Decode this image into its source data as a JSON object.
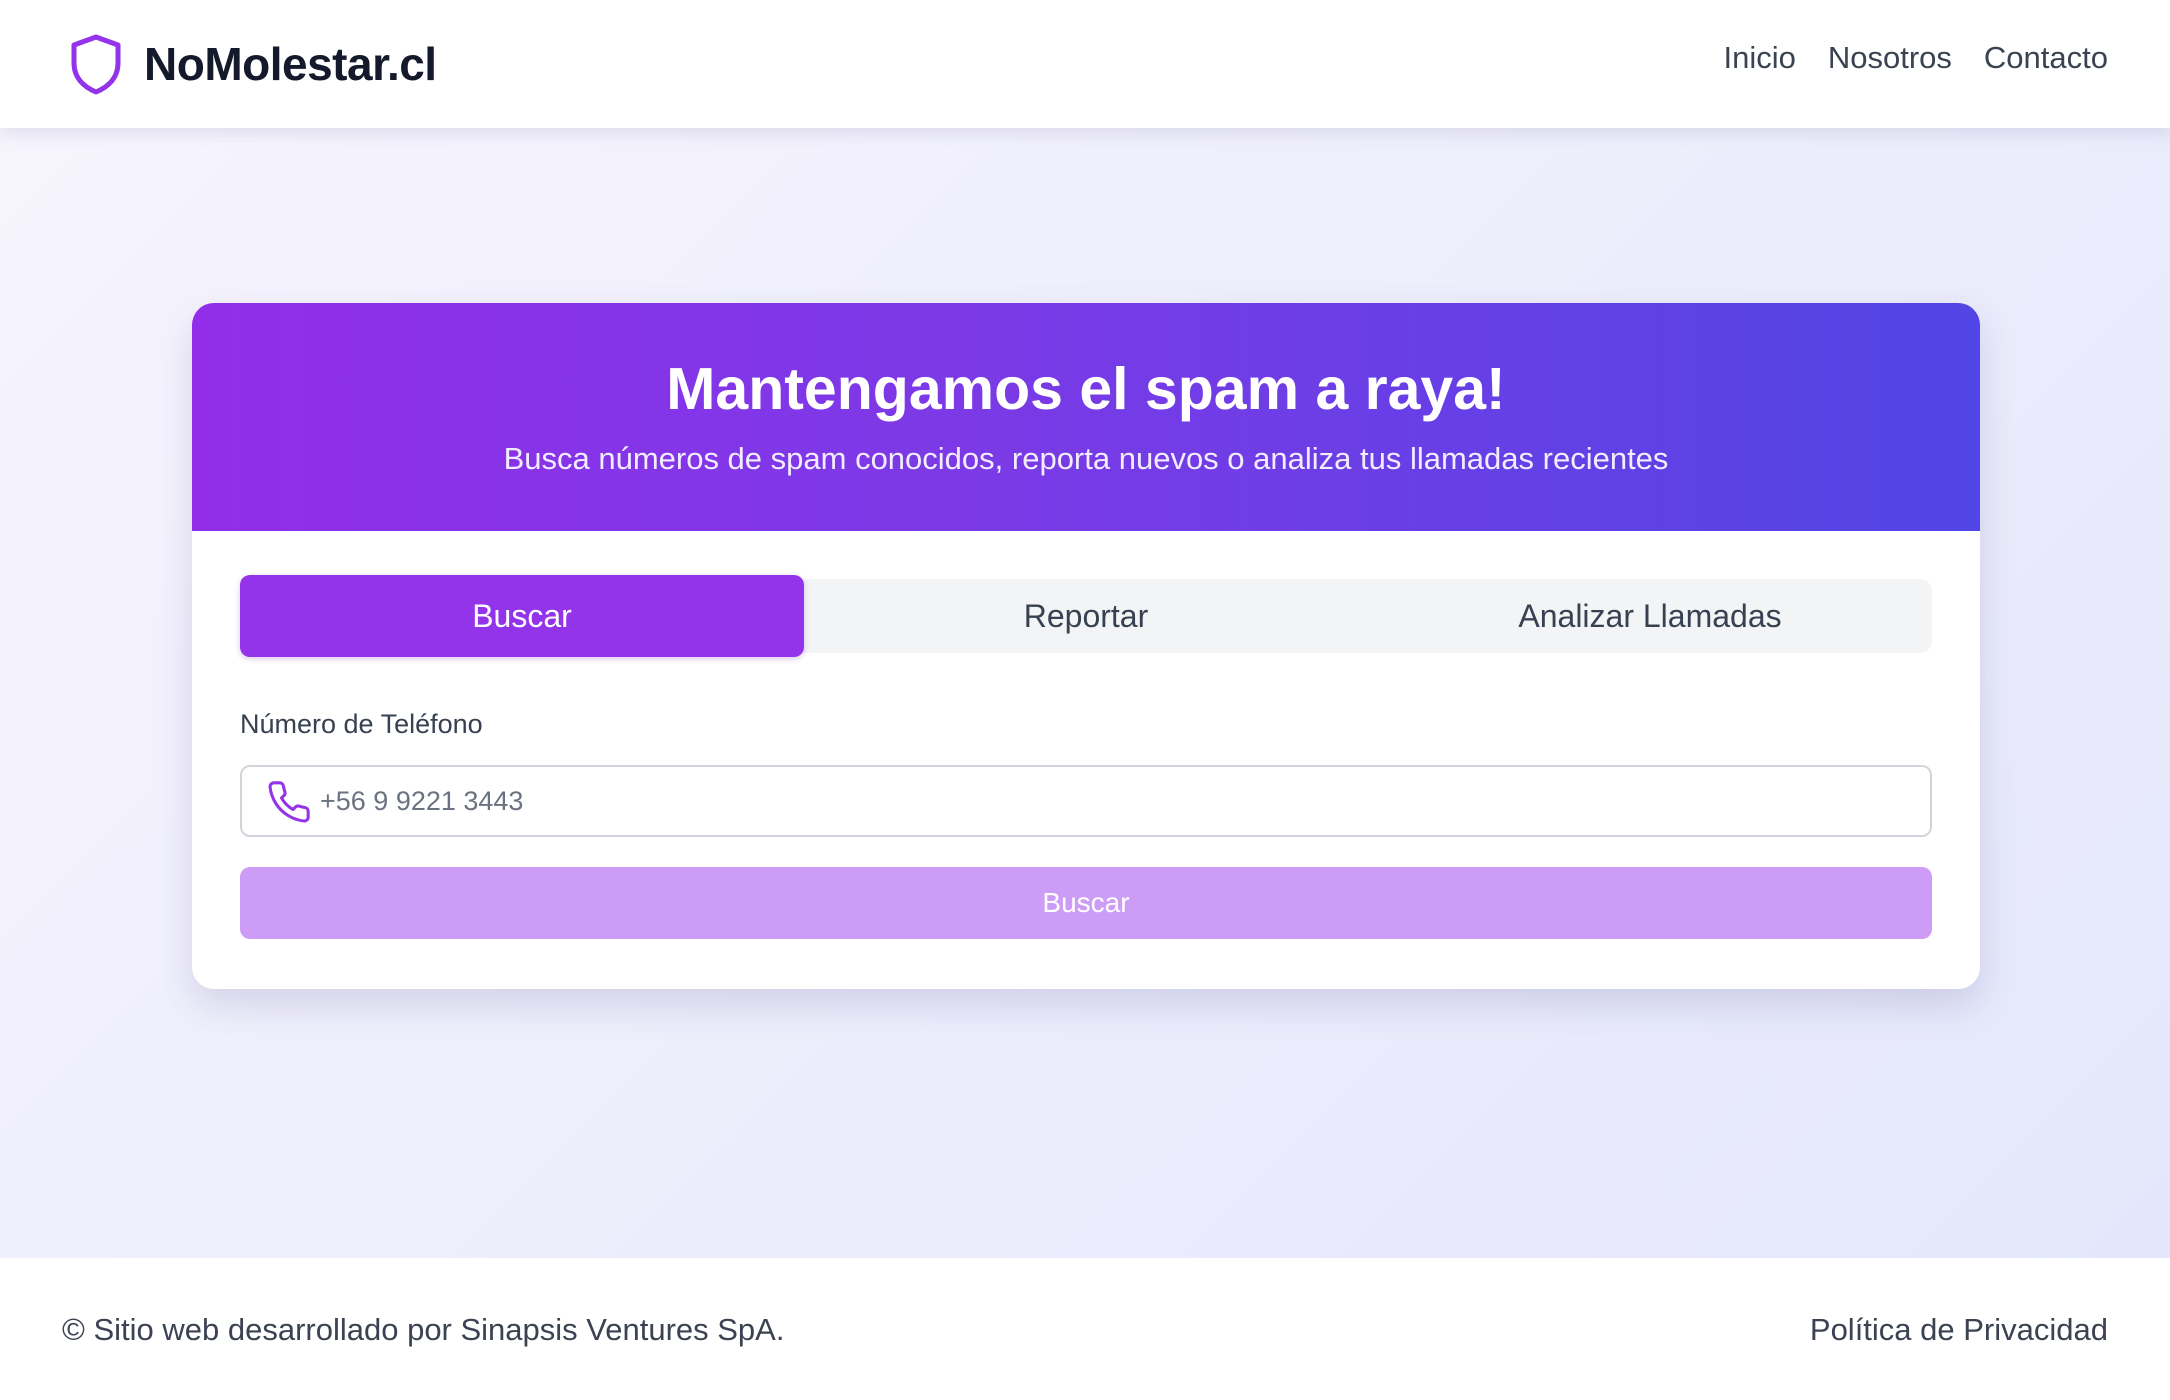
{
  "header": {
    "logo_icon": "shield-icon",
    "brand": "NoMolestar.cl",
    "nav": [
      {
        "label": "Inicio"
      },
      {
        "label": "Nosotros"
      },
      {
        "label": "Contacto"
      }
    ]
  },
  "hero": {
    "title": "Mantengamos el spam a raya!",
    "subtitle": "Busca números de spam conocidos, reporta nuevos o analiza tus llamadas recientes"
  },
  "tabs": [
    {
      "label": "Buscar",
      "active": true
    },
    {
      "label": "Reportar",
      "active": false
    },
    {
      "label": "Analizar Llamadas",
      "active": false
    }
  ],
  "form": {
    "phone_label": "Número de Teléfono",
    "phone_icon": "phone-icon",
    "phone_placeholder": "+56 9 9221 3443",
    "phone_value": "",
    "submit_label": "Buscar"
  },
  "footer": {
    "copyright": "© Sitio web desarrollado por Sinapsis Ventures SpA.",
    "privacy": "Política de Privacidad"
  },
  "colors": {
    "accent": "#9333ea",
    "accent_light": "#cd9cf6",
    "hero_gradient_start": "#922eea",
    "hero_gradient_end": "#5145e5",
    "text_dark": "#141a2c"
  }
}
